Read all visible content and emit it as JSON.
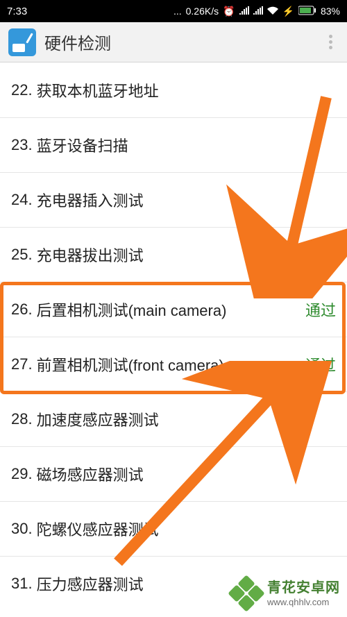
{
  "status": {
    "time": "7:33",
    "net_speed": "0.26K/s",
    "battery": "83%"
  },
  "app": {
    "title": "硬件检测"
  },
  "items": [
    {
      "num": "22.",
      "label": "获取本机蓝牙地址",
      "status": ""
    },
    {
      "num": "23.",
      "label": "蓝牙设备扫描",
      "status": ""
    },
    {
      "num": "24.",
      "label": "充电器插入测试",
      "status": ""
    },
    {
      "num": "25.",
      "label": "充电器拔出测试",
      "status": ""
    },
    {
      "num": "26.",
      "label": "后置相机测试(main camera)",
      "status": "通过"
    },
    {
      "num": "27.",
      "label": "前置相机测试(front camera)",
      "status": "通过"
    },
    {
      "num": "28.",
      "label": "加速度感应器测试",
      "status": ""
    },
    {
      "num": "29.",
      "label": "磁场感应器测试",
      "status": ""
    },
    {
      "num": "30.",
      "label": "陀螺仪感应器测试",
      "status": ""
    },
    {
      "num": "31.",
      "label": "压力感应器测试",
      "status": ""
    }
  ],
  "watermark": {
    "name": "青花安卓网",
    "url": "www.qhhlv.com"
  }
}
